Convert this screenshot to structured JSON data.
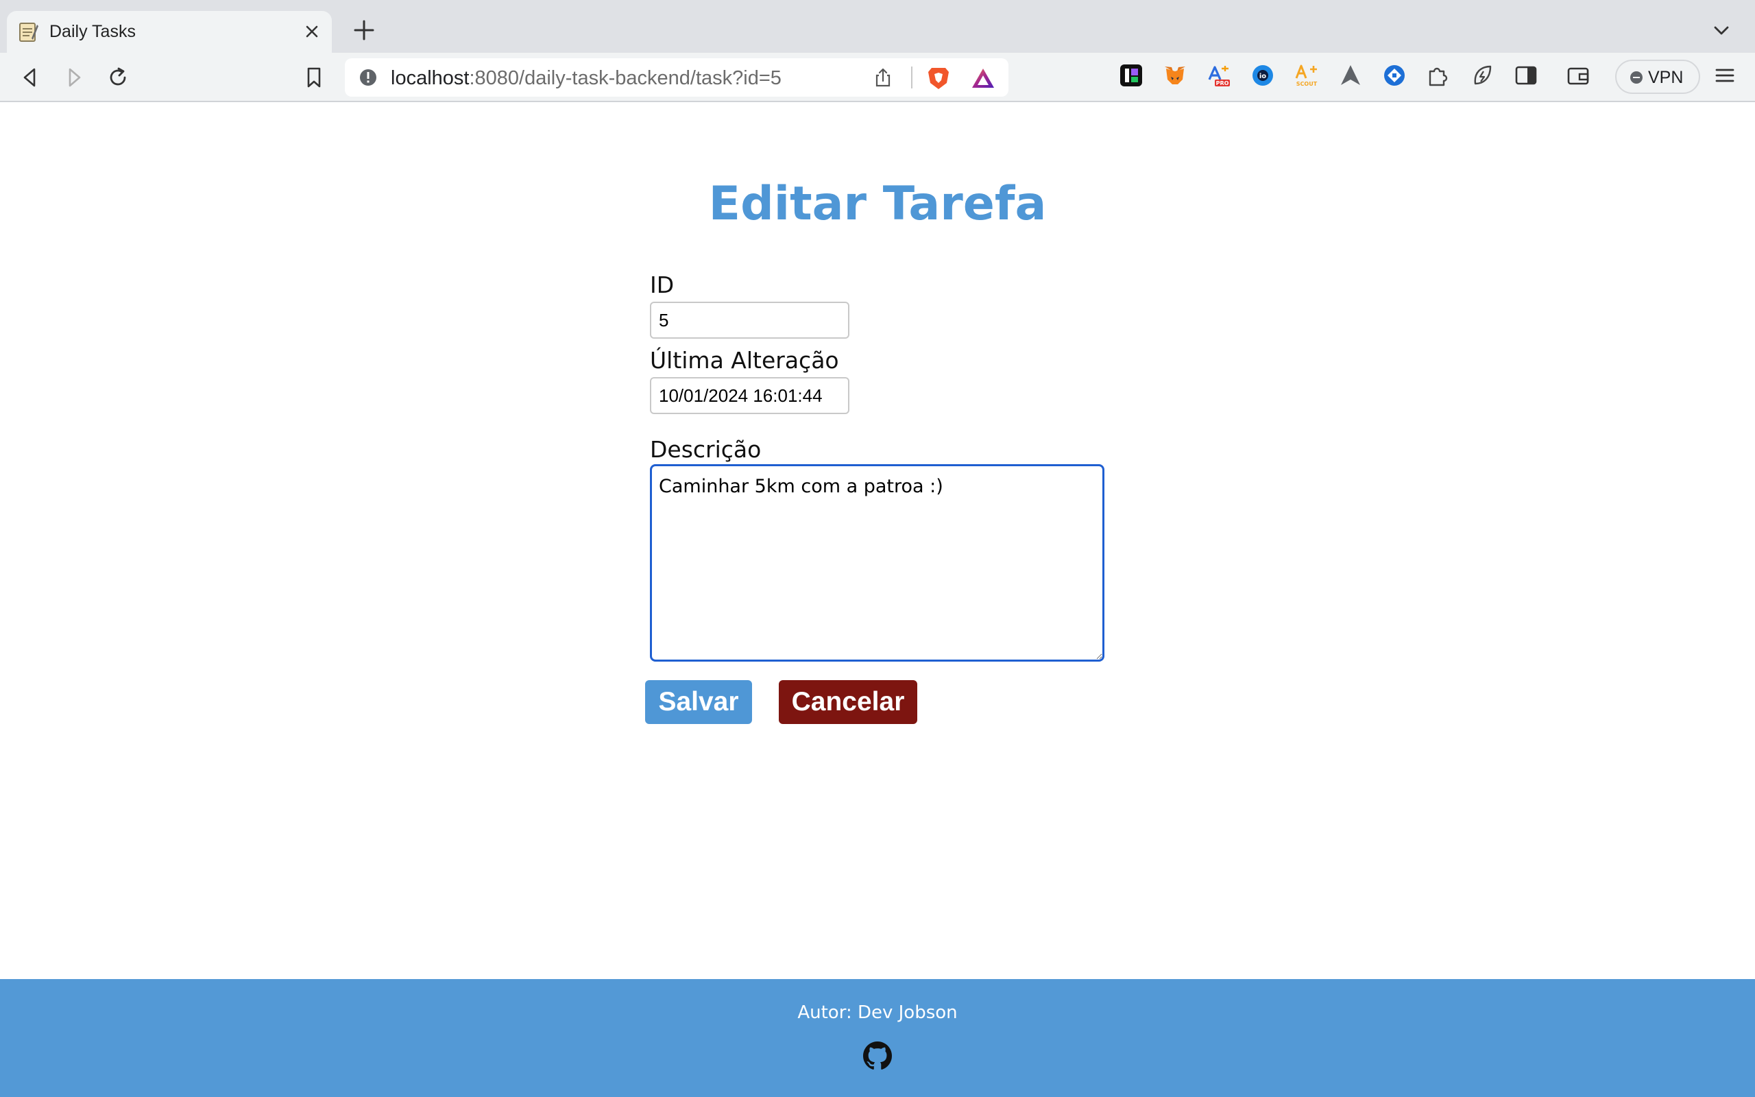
{
  "browser": {
    "tab": {
      "title": "Daily Tasks",
      "favicon": "notepad-icon"
    },
    "url": {
      "host": "localhost",
      "rest": ":8080/daily-task-backend/task?id=5"
    },
    "vpn_label": "VPN",
    "extensions": [
      "leetcode-icon",
      "metamask-icon",
      "adblock-pro-icon",
      "ie-icon",
      "scout-icon",
      "arc-icon",
      "jira-icon",
      "puzzle-icon",
      "leaf-icon",
      "sidebar-icon",
      "wallet-icon"
    ]
  },
  "page": {
    "title": "Editar Tarefa",
    "fields": {
      "id_label": "ID",
      "id_value": "5",
      "updated_label": "Última Alteração",
      "updated_value": "10/01/2024 16:01:44",
      "description_label": "Descrição",
      "description_value": "Caminhar 5km com a patroa :)"
    },
    "buttons": {
      "save": "Salvar",
      "cancel": "Cancelar"
    },
    "colors": {
      "title": "#4f97d6",
      "save": "#4f97d6",
      "cancel": "#7d1510",
      "footer": "#5399d6"
    }
  },
  "footer": {
    "author": "Autor: Dev Jobson",
    "icon": "github-icon"
  }
}
